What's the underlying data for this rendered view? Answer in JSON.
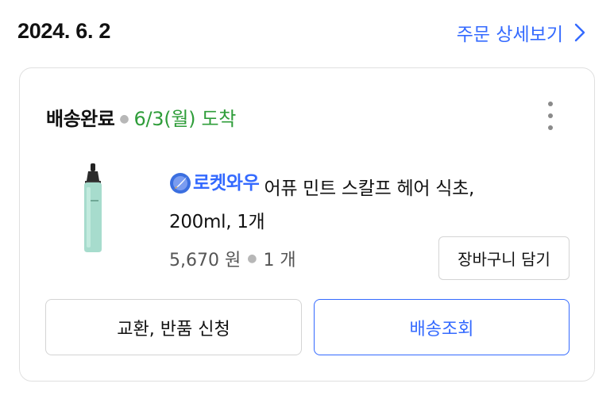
{
  "order": {
    "date": "2024. 6. 2",
    "detail_link": "주문 상세보기"
  },
  "shipment": {
    "status": "배송완료",
    "arrival": "6/3(월) 도착"
  },
  "product": {
    "badge": "로켓와우",
    "name_line1": "어퓨 민트 스칼프 헤어 식초,",
    "name_line2": "200ml, 1개",
    "price": "5,670 원",
    "quantity": "1 개"
  },
  "buttons": {
    "add_to_cart": "장바구니 담기",
    "return_exchange": "교환, 반품 신청",
    "track_delivery": "배송조회"
  },
  "colors": {
    "accent": "#346aff",
    "arrival_green": "#2f9d3a",
    "border": "#d4d4d4"
  },
  "icons": {
    "detail_chevron": "chevron-right-icon",
    "more": "more-vertical-icon",
    "badge": "rocket-icon"
  }
}
